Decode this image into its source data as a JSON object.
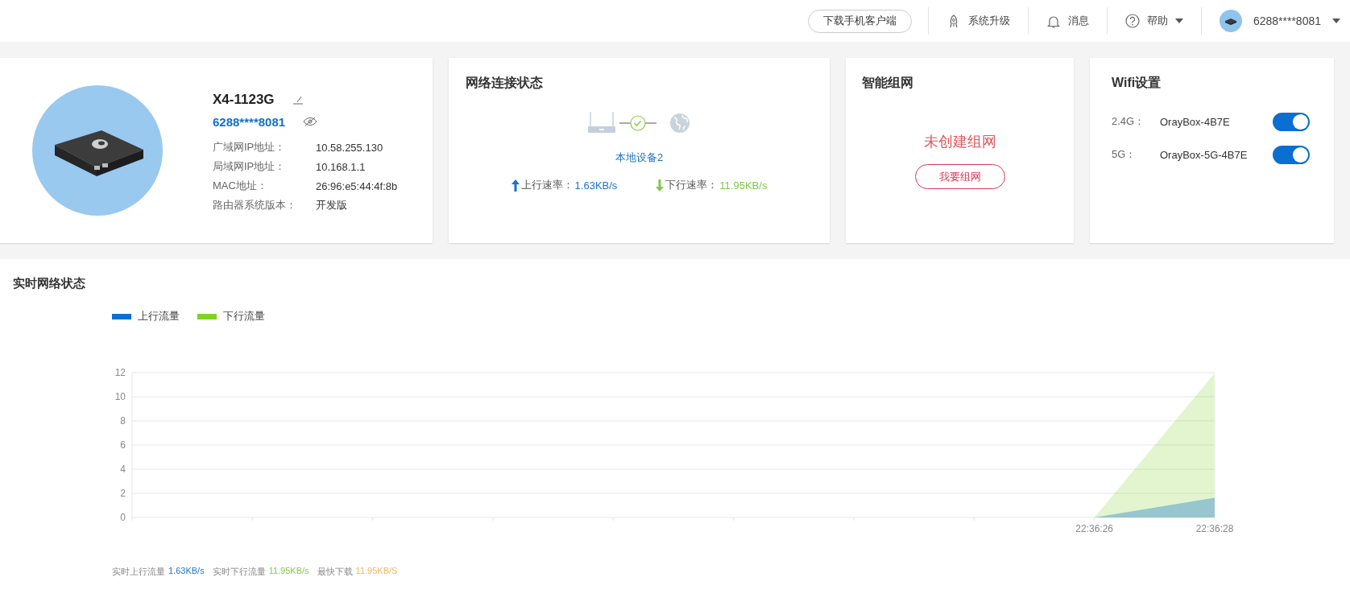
{
  "top_bar": {
    "download_button": "下载手机客户端",
    "items": [
      {
        "kind": "rocket",
        "label": "系统升级"
      },
      {
        "kind": "bell",
        "label": "消息"
      },
      {
        "kind": "help",
        "label": "帮助",
        "caret": true
      }
    ],
    "account": {
      "name": "6288****8081",
      "caret": true
    }
  },
  "device": {
    "name": "X4-1123G",
    "id": "6288****8081",
    "info": [
      {
        "label": "广域网IP地址：",
        "value": "10.58.255.130"
      },
      {
        "label": "局域网IP地址：",
        "value": "10.168.1.1"
      },
      {
        "label": "MAC地址：",
        "value": "26:96:e5:44:4f:8b"
      },
      {
        "label": "路由器系统版本：",
        "value": "开发版"
      }
    ]
  },
  "network_status": {
    "title": "网络连接状态",
    "connected": true,
    "device_link": "本地设备2",
    "rates": [
      {
        "kind": "up",
        "label": "上行速率：",
        "value": "1.63KB/s",
        "color": "#1a73c8"
      },
      {
        "kind": "down",
        "label": "下行速率：",
        "value": "11.95KB/s",
        "color": "#7ec84a"
      }
    ]
  },
  "mesh": {
    "title": "智能组网",
    "status": "未创建组网",
    "button": "我要组网"
  },
  "wifi": {
    "title": "Wifi设置",
    "bands": [
      {
        "label": "2.4G：",
        "ssid": "OrayBox-4B7E",
        "on": true
      },
      {
        "label": "5G：",
        "ssid": "OrayBox-5G-4B7E",
        "on": true
      }
    ]
  },
  "realtime": {
    "title": "实时网络状态",
    "chart_data": {
      "type": "area",
      "categories": [
        null,
        null,
        null,
        null,
        null,
        null,
        null,
        null,
        "22:36:26",
        "22:36:28"
      ],
      "ylim": [
        0,
        12
      ],
      "grid": true,
      "legend": "top-left",
      "yticks": [
        0,
        2,
        4,
        6,
        8,
        10,
        12
      ],
      "series": [
        {
          "name": "上行流量",
          "color": "#0a6fd0",
          "values": [
            null,
            null,
            null,
            null,
            null,
            null,
            null,
            null,
            0,
            1.63
          ]
        },
        {
          "name": "下行流量",
          "color": "#7ed321",
          "values": [
            null,
            null,
            null,
            null,
            null,
            null,
            null,
            null,
            0,
            11.95
          ]
        }
      ]
    },
    "stats": [
      {
        "label": "实时上行流量",
        "value": "1.63KB/s",
        "color": "#1a73c8"
      },
      {
        "label": "实时下行流量",
        "value": "11.95KB/s",
        "color": "#7ec84a"
      },
      {
        "label": "最快下载",
        "value": "11.95KB/S",
        "color": "#f0b561"
      }
    ]
  }
}
